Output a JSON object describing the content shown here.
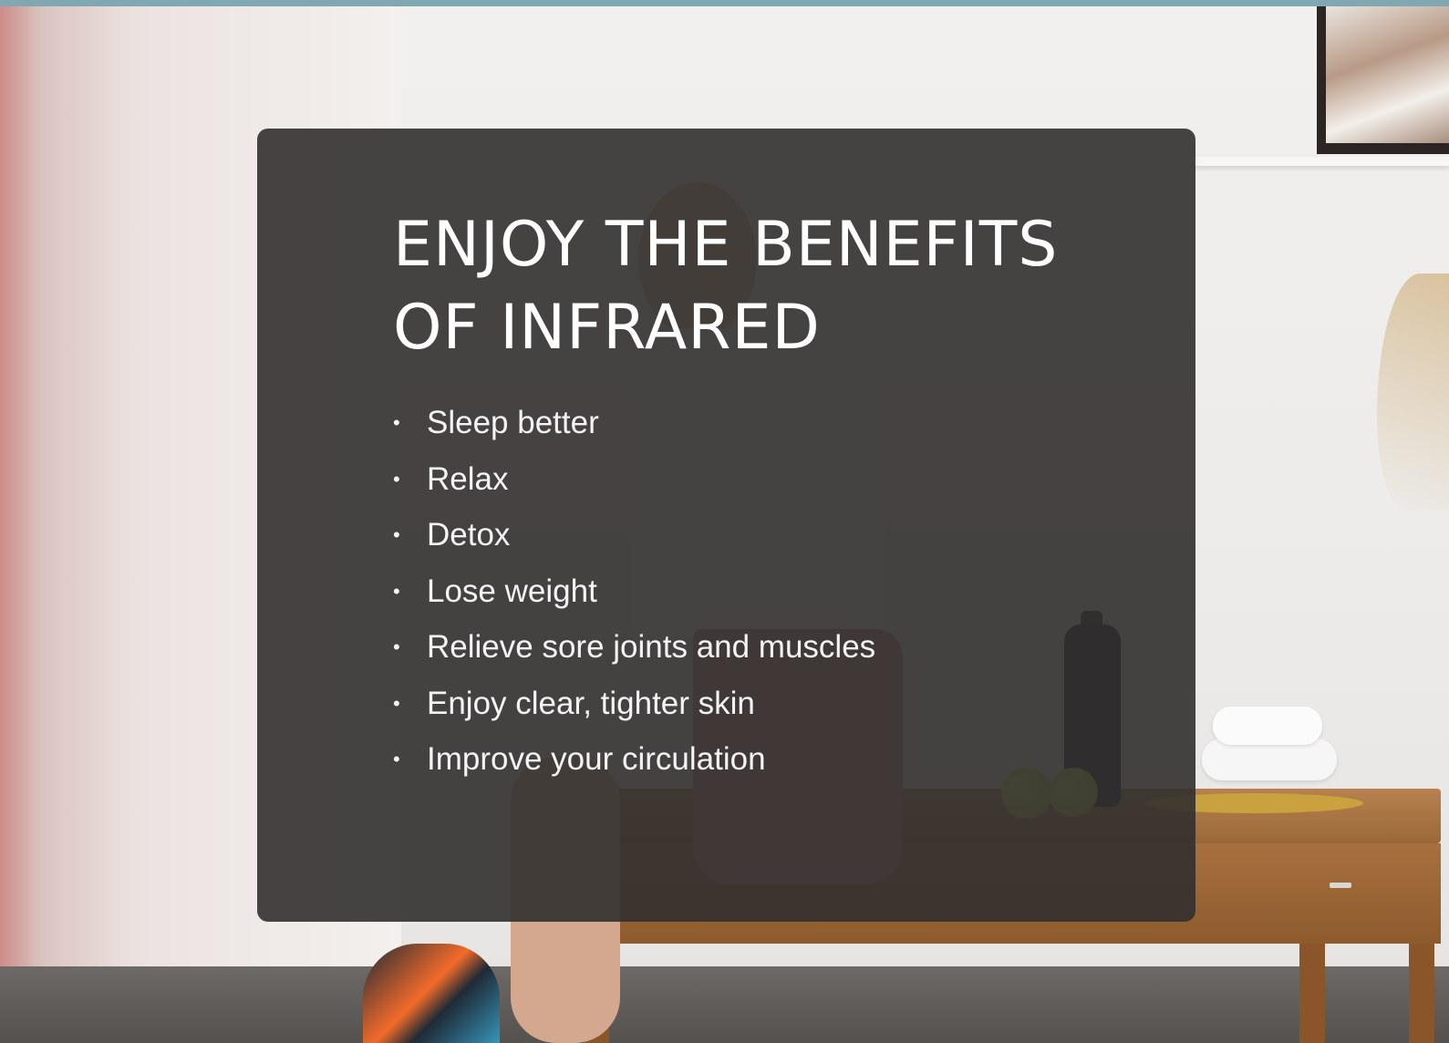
{
  "hero": {
    "title": "ENJOY THE BENEFITS OF INFRARED",
    "benefits": [
      "Sleep better",
      "Relax",
      "Detox",
      "Lose weight",
      "Relieve sore joints and muscles",
      "Enjoy clear, tighter skin",
      "Improve your circulation"
    ],
    "bullet_glyph": "•"
  },
  "colors": {
    "top_bar": "#7fa8b3",
    "card_background": "#32302f",
    "card_text": "#ffffff"
  },
  "icons": {
    "bullet": "bullet-dot"
  }
}
